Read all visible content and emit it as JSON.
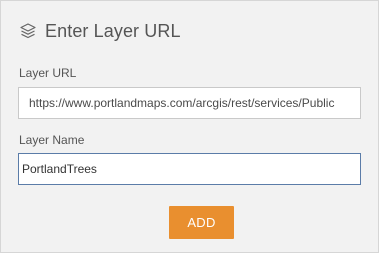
{
  "panel": {
    "title": "Enter Layer URL",
    "title_icon": "layers-icon"
  },
  "fields": {
    "layer_url": {
      "label": "Layer URL",
      "value": "https://www.portlandmaps.com/arcgis/rest/services/Public"
    },
    "layer_name": {
      "label": "Layer Name",
      "value": "PortlandTrees"
    }
  },
  "actions": {
    "add_label": "ADD"
  },
  "colors": {
    "panel_bg": "#f2f2f2",
    "accent": "#e98f2f",
    "focus_border": "#5b7ca8",
    "text": "#555555"
  }
}
